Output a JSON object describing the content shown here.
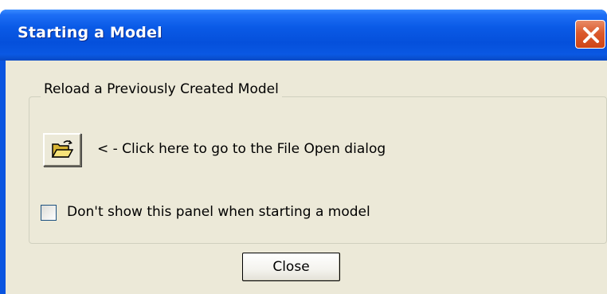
{
  "window": {
    "title": "Starting a Model",
    "close_icon": "close-icon"
  },
  "group": {
    "legend": "Reload a Previously Created Model",
    "open_button_icon": "folder-open-icon",
    "open_hint": "< - Click here to go to the File Open dialog",
    "checkbox_label": "Don't show this panel when starting a model",
    "checkbox_checked": false
  },
  "footer": {
    "close_label": "Close"
  },
  "colors": {
    "title_bar": "#0a55e0",
    "client_bg": "#ece9d8",
    "close_button_red": "#db5a2d"
  }
}
